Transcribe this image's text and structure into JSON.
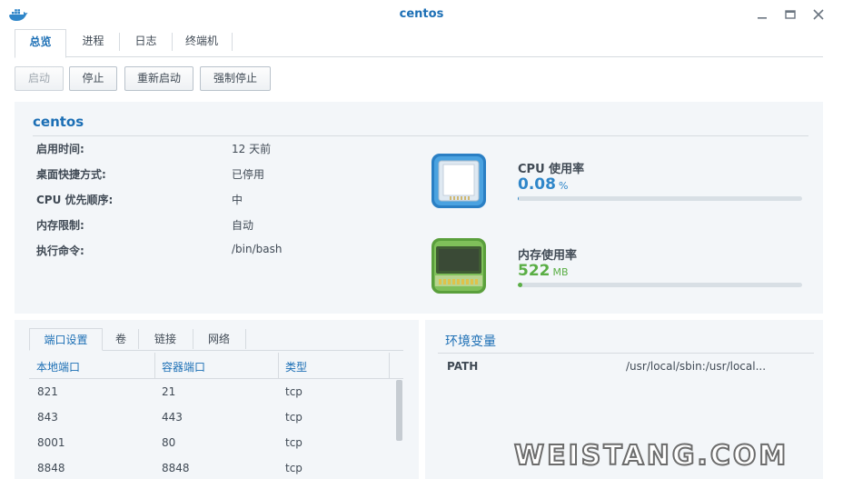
{
  "window": {
    "title": "centos"
  },
  "tabs": [
    "总览",
    "进程",
    "日志",
    "终端机"
  ],
  "toolbar": {
    "start": "启动",
    "stop": "停止",
    "restart": "重新启动",
    "force_stop": "强制停止"
  },
  "overview": {
    "name": "centos",
    "fields": [
      {
        "label": "启用时间:",
        "value": "12 天前"
      },
      {
        "label": "桌面快捷方式:",
        "value": "已停用"
      },
      {
        "label": "CPU 优先顺序:",
        "value": "中"
      },
      {
        "label": "内存限制:",
        "value": "自动"
      },
      {
        "label": "执行命令:",
        "value": "/bin/bash"
      }
    ],
    "cpu": {
      "title": "CPU 使用率",
      "value": "0.08",
      "unit": "%",
      "percent": 0.08,
      "color": "#2f86c9"
    },
    "memory": {
      "title": "内存使用率",
      "value": "522",
      "unit": "MB",
      "percent": 1.5,
      "color": "#5aae45"
    }
  },
  "ports": {
    "tabs": [
      "端口设置",
      "卷",
      "链接",
      "网络"
    ],
    "columns": [
      "本地端口",
      "容器端口",
      "类型"
    ],
    "rows": [
      [
        "821",
        "21",
        "tcp"
      ],
      [
        "843",
        "443",
        "tcp"
      ],
      [
        "8001",
        "80",
        "tcp"
      ],
      [
        "8848",
        "8848",
        "tcp"
      ]
    ]
  },
  "env": {
    "title": "环境变量",
    "items": [
      {
        "key": "PATH",
        "value": "/usr/local/sbin:/usr/local..."
      }
    ]
  },
  "watermark": "WEISTANG.COM"
}
